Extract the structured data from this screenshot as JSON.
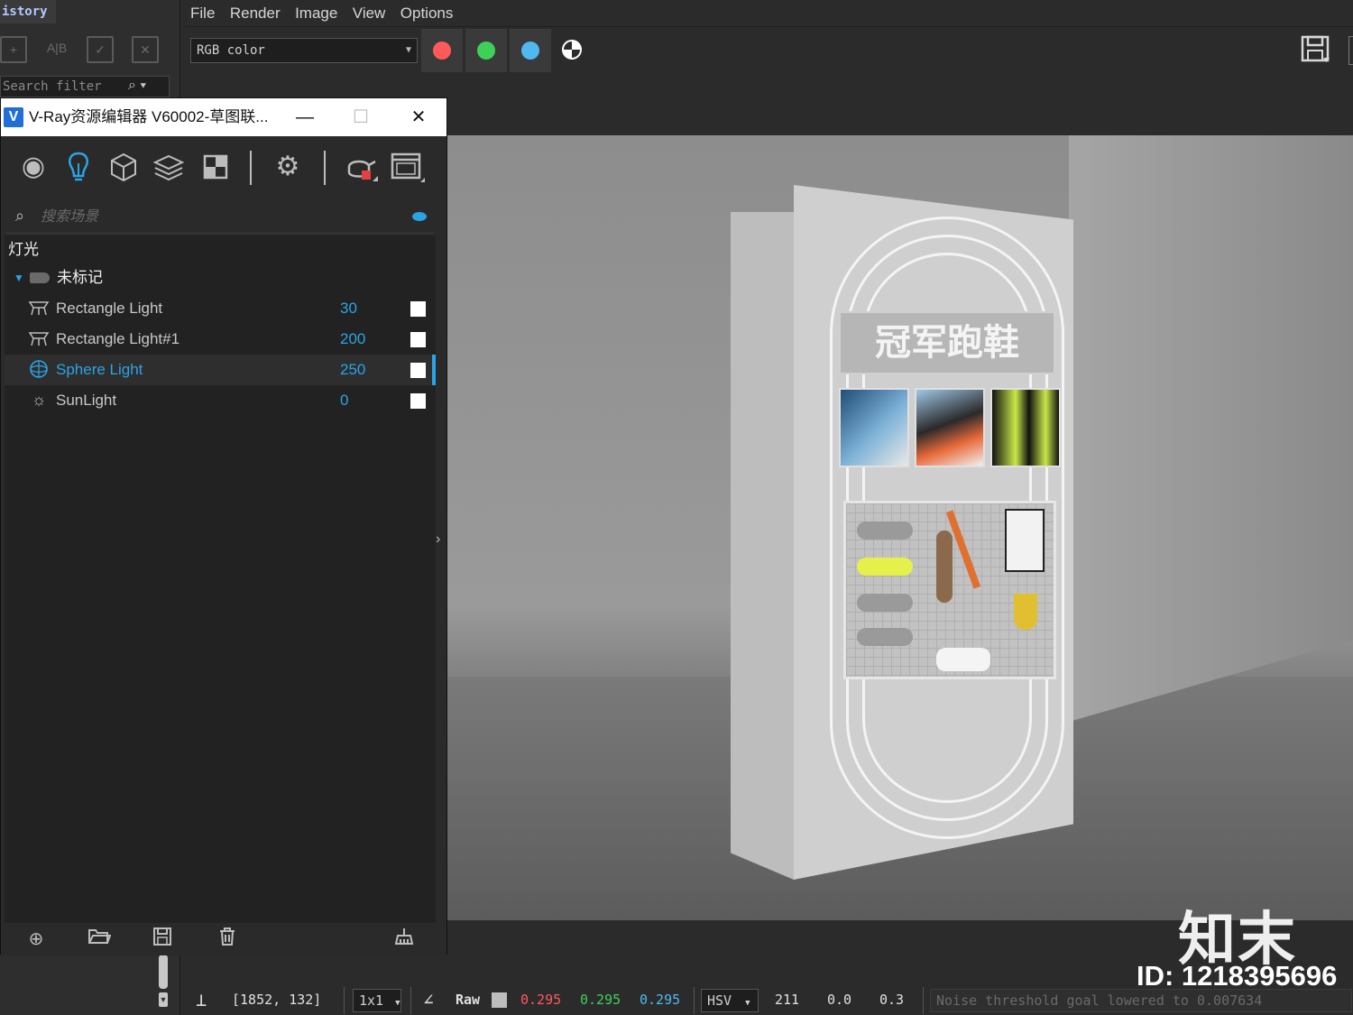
{
  "history": {
    "title": "istory",
    "search_placeholder": "Search filter"
  },
  "menu": {
    "items": [
      "File",
      "Render",
      "Image",
      "View",
      "Options"
    ]
  },
  "toolbar": {
    "channel": "RGB color",
    "channel_colors": {
      "red": "#ff5a5a",
      "green": "#3fd05a",
      "blue": "#50b8f0"
    }
  },
  "vray": {
    "window_title": "V-Ray资源编辑器 V60002-草图联...",
    "search_placeholder": "搜索场景",
    "category": "灯光",
    "group": "未标记",
    "lights": [
      {
        "name": "Rectangle Light",
        "value": "30",
        "icon": "rectangle-light-icon"
      },
      {
        "name": "Rectangle Light#1",
        "value": "200",
        "icon": "rectangle-light-icon"
      },
      {
        "name": "Sphere Light",
        "value": "250",
        "icon": "sphere-light-icon",
        "selected": true
      },
      {
        "name": "SunLight",
        "value": "0",
        "icon": "sun-icon"
      }
    ],
    "accent_color": "#2ba4e6"
  },
  "render": {
    "sign_text": "冠军跑鞋"
  },
  "status": {
    "coords": "[1852, 132]",
    "zoom": "1x1",
    "mode": "Raw",
    "r": "0.295",
    "g": "0.295",
    "b": "0.295",
    "color_space": "HSV",
    "h": "211",
    "s": "0.0",
    "v": "0.3",
    "message": "Noise threshold goal lowered to 0.007634"
  },
  "watermark": {
    "logo": "知末",
    "id": "ID: 1218395696"
  }
}
